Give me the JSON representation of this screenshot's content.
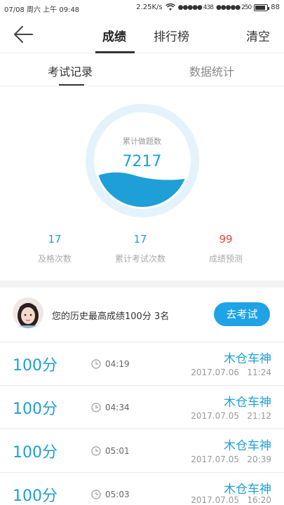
{
  "status_bar": {
    "date_time": "07/08 周六 上午 09:48",
    "speed": "2.25K/s",
    "signal1": "●●●●● 438",
    "signal2": "●●●●● 250",
    "battery": "88",
    "battery_level": 0.88
  },
  "nav": {
    "tabs": [
      {
        "label": "成绩",
        "active": true
      },
      {
        "label": "排行榜",
        "active": false
      }
    ],
    "clear_label": "清空"
  },
  "sub_tabs": [
    {
      "label": "考试记录",
      "active": true
    },
    {
      "label": "数据统计",
      "active": false
    }
  ],
  "gauge": {
    "label": "累计做题数",
    "value": "7217"
  },
  "stats": [
    {
      "value": "17",
      "label": "及格次数"
    },
    {
      "value": "17",
      "label": "累计考试次数"
    },
    {
      "value": "99",
      "label": "成绩预测"
    }
  ],
  "best": {
    "text": "您的历史最高成绩100分  3名",
    "button_label": "去考试"
  },
  "records": [
    {
      "score": "100分",
      "duration": "04:19",
      "name": "木仓车神",
      "date": "2017.07.06   11:24"
    },
    {
      "score": "100分",
      "duration": "04:34",
      "name": "木仓车神",
      "date": "2017.07.05   21:12"
    },
    {
      "score": "100分",
      "duration": "05:01",
      "name": "木仓车神",
      "date": "2017.07.05   20:39"
    },
    {
      "score": "100分",
      "duration": "05:03",
      "name": "木仓车神",
      "date": "2017.07.05   16:20"
    }
  ],
  "colors": {
    "accent": "#1e9fd8",
    "button": "#1ea3e6",
    "prediction": "#e64545"
  }
}
